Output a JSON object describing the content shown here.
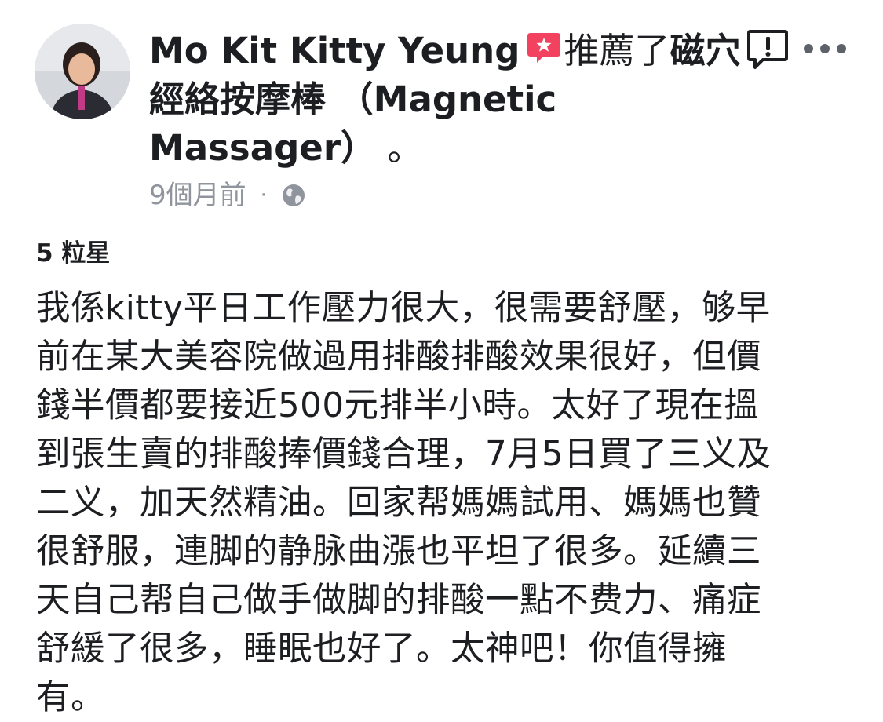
{
  "post": {
    "author": "Mo Kit Kitty Yeung",
    "recommend_text_before": "推薦了",
    "product": "磁穴經絡按摩棒 （Magnetic Massager）",
    "recommend_text_after": " 。",
    "time_ago": "9個月前",
    "meta_separator": "·",
    "privacy_icon": "globe-icon",
    "recommend_icon": "recommend-speech-bubble-star-icon",
    "recommend_icon_color": "#f3425f",
    "report_icon": "report-speech-bubble-exclamation-icon",
    "more_icon": "more-dots-icon"
  },
  "review": {
    "rating": "5 粒星",
    "lines": [
      "我係kitty平日工作壓力很大，很需要舒壓，够早",
      "前在某大美容院做過用排酸排酸效果很好，但價",
      "錢半價都要接近500元排半小時。太好了現在搵",
      "到張生賣的排酸捧價錢合理，7月5日買了三义及",
      "二义，加天然精油。回家帮媽媽試用、媽媽也贊",
      "很舒服，連脚的静脉曲漲也平坦了很多。延續三",
      "天自己帮自己做手做脚的排酸一點不费力、痛症",
      "舒緩了很多，睡眠也好了。太神吧！你值得擁",
      "有。"
    ]
  }
}
